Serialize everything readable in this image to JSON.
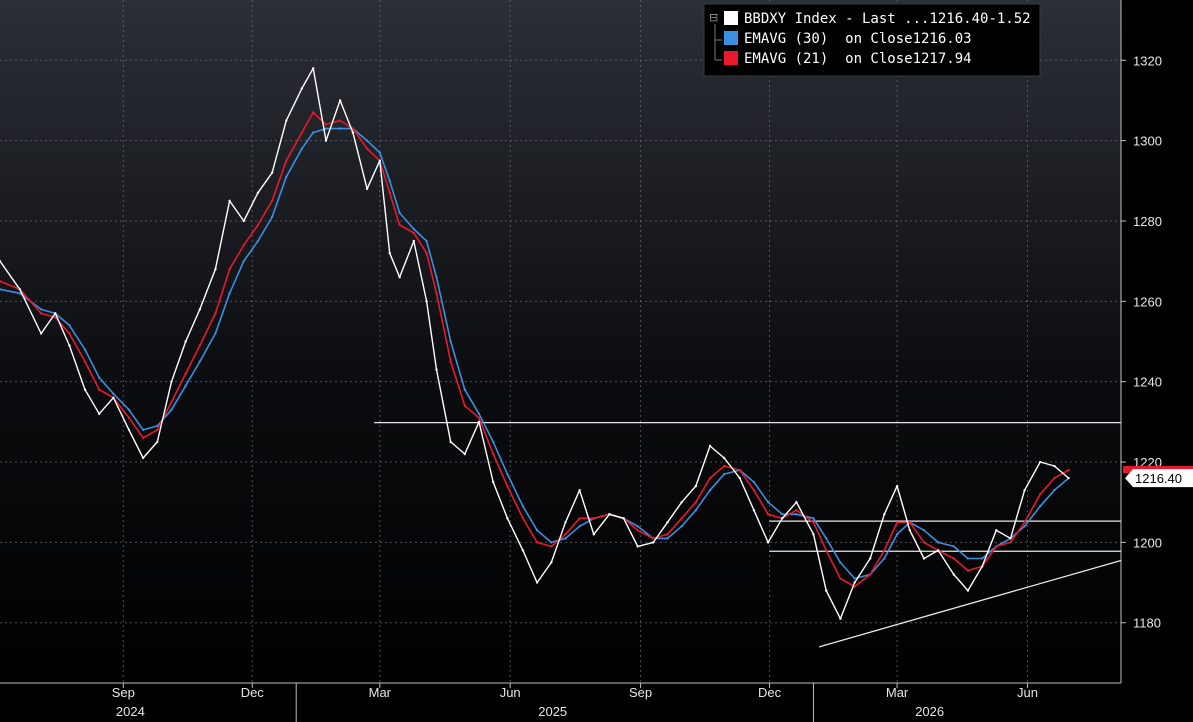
{
  "chart_data": {
    "type": "line",
    "ticker": "BBDXY Index",
    "ylim": [
      1165,
      1335
    ],
    "yticks": [
      1180,
      1200,
      1220,
      1240,
      1260,
      1280,
      1300,
      1320
    ],
    "x_start": "2024-06-06",
    "x_end": "2026-08-06",
    "month_ticks": [
      {
        "label": "Sep",
        "date": "2024-09-01"
      },
      {
        "label": "Dec",
        "date": "2024-12-01"
      },
      {
        "label": "Mar",
        "date": "2025-03-01"
      },
      {
        "label": "Jun",
        "date": "2025-06-01"
      },
      {
        "label": "Sep",
        "date": "2025-09-01"
      },
      {
        "label": "Dec",
        "date": "2025-12-01"
      },
      {
        "label": "Mar",
        "date": "2026-03-01"
      },
      {
        "label": "Jun",
        "date": "2026-06-01"
      }
    ],
    "year_labels": [
      {
        "label": "2024",
        "date": "2024-09-06"
      },
      {
        "label": "2025",
        "date": "2025-07-01"
      },
      {
        "label": "2026",
        "date": "2026-03-24"
      }
    ],
    "year_boundaries": [
      "2025-01-01",
      "2026-01-01"
    ],
    "series": [
      {
        "name": "BBDXY Index - Last ...",
        "value_label": "1216.40",
        "change_label": "-1.52",
        "color": "#ffffff",
        "points": [
          [
            "2024-06-06",
            1270
          ],
          [
            "2024-06-20",
            1263
          ],
          [
            "2024-07-05",
            1252
          ],
          [
            "2024-07-15",
            1257
          ],
          [
            "2024-07-25",
            1249
          ],
          [
            "2024-08-05",
            1238
          ],
          [
            "2024-08-15",
            1232
          ],
          [
            "2024-08-25",
            1236
          ],
          [
            "2024-09-05",
            1228
          ],
          [
            "2024-09-15",
            1221
          ],
          [
            "2024-09-25",
            1225
          ],
          [
            "2024-10-05",
            1240
          ],
          [
            "2024-10-15",
            1250
          ],
          [
            "2024-10-25",
            1258
          ],
          [
            "2024-11-05",
            1268
          ],
          [
            "2024-11-15",
            1285
          ],
          [
            "2024-11-25",
            1280
          ],
          [
            "2024-12-05",
            1287
          ],
          [
            "2024-12-15",
            1292
          ],
          [
            "2024-12-25",
            1305
          ],
          [
            "2025-01-05",
            1313
          ],
          [
            "2025-01-13",
            1318
          ],
          [
            "2025-01-22",
            1300
          ],
          [
            "2025-02-01",
            1310
          ],
          [
            "2025-02-10",
            1302
          ],
          [
            "2025-02-20",
            1288
          ],
          [
            "2025-03-01",
            1295
          ],
          [
            "2025-03-08",
            1272
          ],
          [
            "2025-03-15",
            1266
          ],
          [
            "2025-03-25",
            1275
          ],
          [
            "2025-04-03",
            1260
          ],
          [
            "2025-04-10",
            1243
          ],
          [
            "2025-04-20",
            1225
          ],
          [
            "2025-04-30",
            1222
          ],
          [
            "2025-05-10",
            1230
          ],
          [
            "2025-05-20",
            1215
          ],
          [
            "2025-05-30",
            1206
          ],
          [
            "2025-06-10",
            1198
          ],
          [
            "2025-06-20",
            1190
          ],
          [
            "2025-06-30",
            1195
          ],
          [
            "2025-07-10",
            1205
          ],
          [
            "2025-07-20",
            1213
          ],
          [
            "2025-07-30",
            1202
          ],
          [
            "2025-08-10",
            1207
          ],
          [
            "2025-08-20",
            1206
          ],
          [
            "2025-08-30",
            1199
          ],
          [
            "2025-09-10",
            1200
          ],
          [
            "2025-09-20",
            1205
          ],
          [
            "2025-09-30",
            1210
          ],
          [
            "2025-10-10",
            1214
          ],
          [
            "2025-10-20",
            1224
          ],
          [
            "2025-10-30",
            1221
          ],
          [
            "2025-11-10",
            1216
          ],
          [
            "2025-11-20",
            1208
          ],
          [
            "2025-11-30",
            1200
          ],
          [
            "2025-12-10",
            1206
          ],
          [
            "2025-12-20",
            1210
          ],
          [
            "2026-01-01",
            1202
          ],
          [
            "2026-01-10",
            1188
          ],
          [
            "2026-01-20",
            1181
          ],
          [
            "2026-01-30",
            1190
          ],
          [
            "2026-02-10",
            1196
          ],
          [
            "2026-02-20",
            1207
          ],
          [
            "2026-03-01",
            1214
          ],
          [
            "2026-03-10",
            1203
          ],
          [
            "2026-03-20",
            1196
          ],
          [
            "2026-03-30",
            1198
          ],
          [
            "2026-04-10",
            1192
          ],
          [
            "2026-04-20",
            1188
          ],
          [
            "2026-04-30",
            1194
          ],
          [
            "2026-05-10",
            1203
          ],
          [
            "2026-05-20",
            1201
          ],
          [
            "2026-05-30",
            1213
          ],
          [
            "2026-06-10",
            1220
          ],
          [
            "2026-06-20",
            1219
          ],
          [
            "2026-06-30",
            1216
          ]
        ]
      },
      {
        "name": "EMAVG (30)  on Close",
        "value_label": "1216.03",
        "color": "#3b8fe0",
        "points": [
          [
            "2024-06-06",
            1263
          ],
          [
            "2024-06-20",
            1262
          ],
          [
            "2024-07-05",
            1258
          ],
          [
            "2024-07-15",
            1257
          ],
          [
            "2024-07-25",
            1254
          ],
          [
            "2024-08-05",
            1248
          ],
          [
            "2024-08-15",
            1241
          ],
          [
            "2024-08-25",
            1237
          ],
          [
            "2024-09-05",
            1233
          ],
          [
            "2024-09-15",
            1228
          ],
          [
            "2024-09-25",
            1229
          ],
          [
            "2024-10-05",
            1233
          ],
          [
            "2024-10-15",
            1239
          ],
          [
            "2024-10-25",
            1245
          ],
          [
            "2024-11-05",
            1252
          ],
          [
            "2024-11-15",
            1262
          ],
          [
            "2024-11-25",
            1270
          ],
          [
            "2024-12-05",
            1275
          ],
          [
            "2024-12-15",
            1281
          ],
          [
            "2024-12-25",
            1291
          ],
          [
            "2025-01-05",
            1298
          ],
          [
            "2025-01-13",
            1302
          ],
          [
            "2025-01-22",
            1303
          ],
          [
            "2025-02-01",
            1303
          ],
          [
            "2025-02-10",
            1303
          ],
          [
            "2025-02-20",
            1300
          ],
          [
            "2025-03-01",
            1297
          ],
          [
            "2025-03-08",
            1290
          ],
          [
            "2025-03-15",
            1282
          ],
          [
            "2025-03-25",
            1278
          ],
          [
            "2025-04-03",
            1275
          ],
          [
            "2025-04-10",
            1266
          ],
          [
            "2025-04-20",
            1250
          ],
          [
            "2025-04-30",
            1238
          ],
          [
            "2025-05-10",
            1232
          ],
          [
            "2025-05-20",
            1225
          ],
          [
            "2025-05-30",
            1217
          ],
          [
            "2025-06-10",
            1209
          ],
          [
            "2025-06-20",
            1203
          ],
          [
            "2025-06-30",
            1200
          ],
          [
            "2025-07-10",
            1201
          ],
          [
            "2025-07-20",
            1204
          ],
          [
            "2025-07-30",
            1206
          ],
          [
            "2025-08-10",
            1207
          ],
          [
            "2025-08-20",
            1206
          ],
          [
            "2025-08-30",
            1204
          ],
          [
            "2025-09-10",
            1201
          ],
          [
            "2025-09-20",
            1201
          ],
          [
            "2025-09-30",
            1204
          ],
          [
            "2025-10-10",
            1208
          ],
          [
            "2025-10-20",
            1213
          ],
          [
            "2025-10-30",
            1217
          ],
          [
            "2025-11-10",
            1218
          ],
          [
            "2025-11-20",
            1215
          ],
          [
            "2025-11-30",
            1210
          ],
          [
            "2025-12-10",
            1207
          ],
          [
            "2025-12-20",
            1207
          ],
          [
            "2026-01-01",
            1206
          ],
          [
            "2026-01-10",
            1201
          ],
          [
            "2026-01-20",
            1195
          ],
          [
            "2026-01-30",
            1191
          ],
          [
            "2026-02-10",
            1192
          ],
          [
            "2026-02-20",
            1196
          ],
          [
            "2026-03-01",
            1202
          ],
          [
            "2026-03-10",
            1205
          ],
          [
            "2026-03-20",
            1203
          ],
          [
            "2026-03-30",
            1200
          ],
          [
            "2026-04-10",
            1199
          ],
          [
            "2026-04-20",
            1196
          ],
          [
            "2026-04-30",
            1196
          ],
          [
            "2026-05-10",
            1199
          ],
          [
            "2026-05-20",
            1201
          ],
          [
            "2026-05-30",
            1204
          ],
          [
            "2026-06-10",
            1209
          ],
          [
            "2026-06-20",
            1213
          ],
          [
            "2026-06-30",
            1216
          ]
        ]
      },
      {
        "name": "EMAVG (21)  on Close",
        "value_label": "1217.94",
        "color": "#e8192c",
        "points": [
          [
            "2024-06-06",
            1265
          ],
          [
            "2024-06-20",
            1263
          ],
          [
            "2024-07-05",
            1257
          ],
          [
            "2024-07-15",
            1256
          ],
          [
            "2024-07-25",
            1252
          ],
          [
            "2024-08-05",
            1245
          ],
          [
            "2024-08-15",
            1238
          ],
          [
            "2024-08-25",
            1236
          ],
          [
            "2024-09-05",
            1231
          ],
          [
            "2024-09-15",
            1226
          ],
          [
            "2024-09-25",
            1228
          ],
          [
            "2024-10-05",
            1235
          ],
          [
            "2024-10-15",
            1242
          ],
          [
            "2024-10-25",
            1249
          ],
          [
            "2024-11-05",
            1257
          ],
          [
            "2024-11-15",
            1268
          ],
          [
            "2024-11-25",
            1274
          ],
          [
            "2024-12-05",
            1279
          ],
          [
            "2024-12-15",
            1285
          ],
          [
            "2024-12-25",
            1295
          ],
          [
            "2025-01-05",
            1302
          ],
          [
            "2025-01-13",
            1307
          ],
          [
            "2025-01-22",
            1304
          ],
          [
            "2025-02-01",
            1305
          ],
          [
            "2025-02-10",
            1303
          ],
          [
            "2025-02-20",
            1298
          ],
          [
            "2025-03-01",
            1295
          ],
          [
            "2025-03-08",
            1287
          ],
          [
            "2025-03-15",
            1279
          ],
          [
            "2025-03-25",
            1277
          ],
          [
            "2025-04-03",
            1272
          ],
          [
            "2025-04-10",
            1262
          ],
          [
            "2025-04-20",
            1245
          ],
          [
            "2025-04-30",
            1234
          ],
          [
            "2025-05-10",
            1231
          ],
          [
            "2025-05-20",
            1222
          ],
          [
            "2025-05-30",
            1214
          ],
          [
            "2025-06-10",
            1206
          ],
          [
            "2025-06-20",
            1200
          ],
          [
            "2025-06-30",
            1199
          ],
          [
            "2025-07-10",
            1202
          ],
          [
            "2025-07-20",
            1206
          ],
          [
            "2025-07-30",
            1206
          ],
          [
            "2025-08-10",
            1207
          ],
          [
            "2025-08-20",
            1206
          ],
          [
            "2025-08-30",
            1203
          ],
          [
            "2025-09-10",
            1201
          ],
          [
            "2025-09-20",
            1202
          ],
          [
            "2025-09-30",
            1206
          ],
          [
            "2025-10-10",
            1210
          ],
          [
            "2025-10-20",
            1216
          ],
          [
            "2025-10-30",
            1219
          ],
          [
            "2025-11-10",
            1218
          ],
          [
            "2025-11-20",
            1213
          ],
          [
            "2025-11-30",
            1207
          ],
          [
            "2025-12-10",
            1206
          ],
          [
            "2025-12-20",
            1208
          ],
          [
            "2026-01-01",
            1205
          ],
          [
            "2026-01-10",
            1198
          ],
          [
            "2026-01-20",
            1191
          ],
          [
            "2026-01-30",
            1189
          ],
          [
            "2026-02-10",
            1192
          ],
          [
            "2026-02-20",
            1198
          ],
          [
            "2026-03-01",
            1205
          ],
          [
            "2026-03-10",
            1205
          ],
          [
            "2026-03-20",
            1200
          ],
          [
            "2026-03-30",
            1198
          ],
          [
            "2026-04-10",
            1196
          ],
          [
            "2026-04-20",
            1193
          ],
          [
            "2026-04-30",
            1194
          ],
          [
            "2026-05-10",
            1199
          ],
          [
            "2026-05-20",
            1200
          ],
          [
            "2026-05-30",
            1205
          ],
          [
            "2026-06-10",
            1212
          ],
          [
            "2026-06-20",
            1216
          ],
          [
            "2026-06-30",
            1218
          ]
        ]
      }
    ],
    "annotations": [
      {
        "name": "resistance-line",
        "from": [
          "2025-02-25",
          1229.8
        ],
        "to": [
          "2026-08-06",
          1229.8
        ]
      },
      {
        "name": "support-line-upper",
        "from": [
          "2025-12-01",
          1205.3
        ],
        "to": [
          "2026-08-06",
          1205.3
        ]
      },
      {
        "name": "support-line-lower",
        "from": [
          "2025-12-01",
          1197.8
        ],
        "to": [
          "2026-08-06",
          1197.8
        ]
      },
      {
        "name": "rising-trendline",
        "from": [
          "2026-01-05",
          1174
        ],
        "to": [
          "2026-08-06",
          1195.5
        ]
      }
    ],
    "last_price_tag": "1216.40",
    "grid": true,
    "legend_position": "top-right"
  }
}
